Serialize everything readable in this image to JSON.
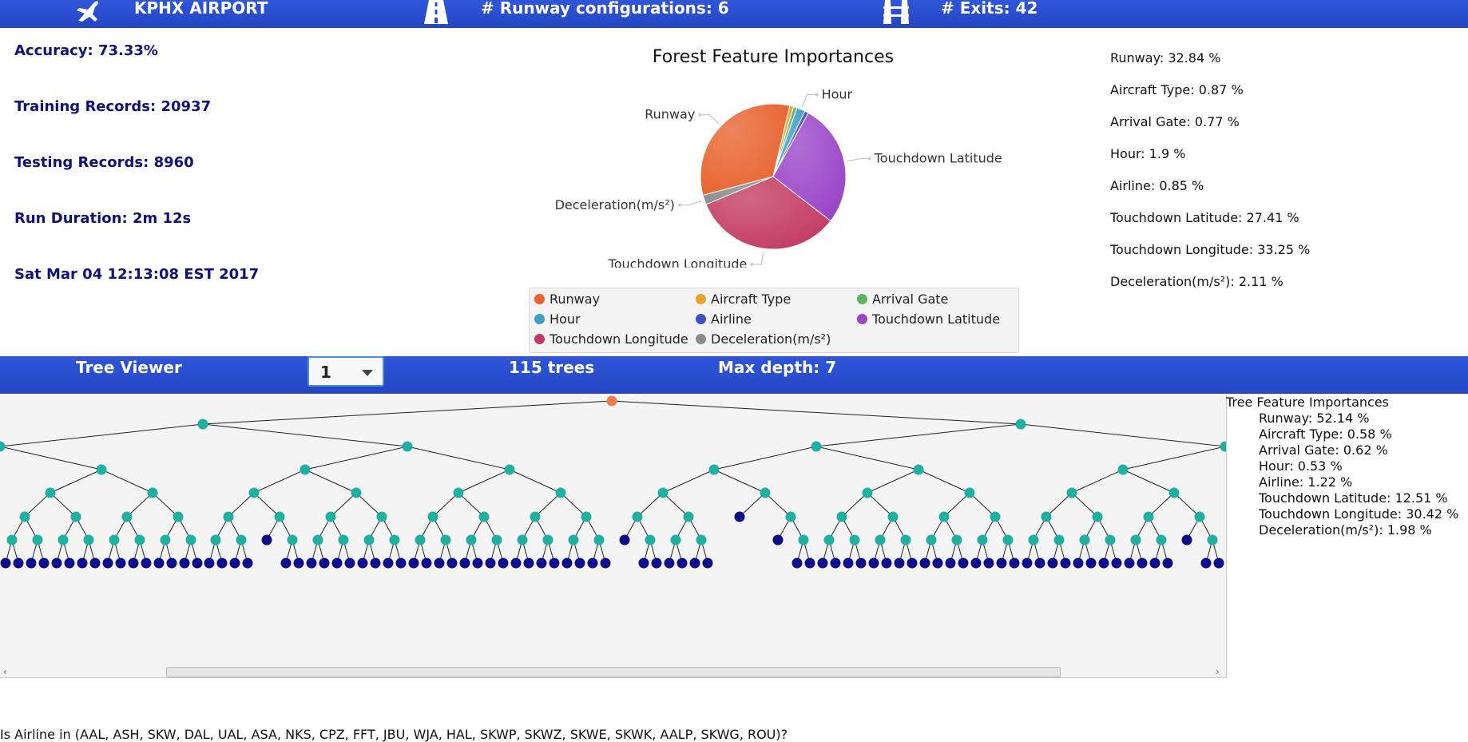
{
  "header": {
    "airport": "KPHX AIRPORT",
    "runway_configs": "# Runway configurations: 6",
    "exits": "# Exits: 42",
    "icons": [
      "airplane-icon",
      "runway-icon",
      "exit-icon"
    ]
  },
  "stats": {
    "accuracy": "Accuracy: 73.33%",
    "training": "Training Records: 20937",
    "testing": "Testing Records: 8960",
    "duration": "Run Duration: 2m 12s",
    "date": "Sat Mar 04 12:13:08 EST 2017"
  },
  "chart_data": {
    "type": "pie",
    "title": "Forest Feature Importances",
    "slices": [
      {
        "label": "Runway",
        "value": 32.84,
        "color": "#e8632e"
      },
      {
        "label": "Aircraft Type",
        "value": 0.87,
        "color": "#eba22b"
      },
      {
        "label": "Arrival Gate",
        "value": 0.77,
        "color": "#5cb35c"
      },
      {
        "label": "Hour",
        "value": 1.9,
        "color": "#3e9fc8"
      },
      {
        "label": "Airline",
        "value": 0.85,
        "color": "#3e52c6"
      },
      {
        "label": "Touchdown Latitude",
        "value": 27.41,
        "color": "#9a45c8"
      },
      {
        "label": "Touchdown Longitude",
        "value": 33.25,
        "color": "#c33b62"
      },
      {
        "label": "Deceleration(m/s²)",
        "value": 2.11,
        "color": "#8a8a8a"
      }
    ],
    "visible_labels": [
      "Runway",
      "Hour",
      "Touchdown Latitude",
      "Touchdown Longitude",
      "Deceleration(m/s²)"
    ],
    "legend_position": "bottom"
  },
  "legend": [
    {
      "label": "Runway",
      "color": "#e8632e"
    },
    {
      "label": "Aircraft Type",
      "color": "#eba22b"
    },
    {
      "label": "Arrival Gate",
      "color": "#5cb35c"
    },
    {
      "label": "Hour",
      "color": "#3e9fc8"
    },
    {
      "label": "Airline",
      "color": "#3e52c6"
    },
    {
      "label": "Touchdown Latitude",
      "color": "#9a45c8"
    },
    {
      "label": "Touchdown Longitude",
      "color": "#c33b62"
    },
    {
      "label": "Deceleration(m/s²)",
      "color": "#8a8a8a"
    }
  ],
  "forest_importances": [
    "Runway: 32.84 %",
    "Aircraft Type: 0.87 %",
    "Arrival Gate: 0.77 %",
    "Hour: 1.9 %",
    "Airline: 0.85 %",
    "Touchdown Latitude: 27.41 %",
    "Touchdown Longitude: 33.25 %",
    "Deceleration(m/s²): 2.11 %"
  ],
  "tree_viewer": {
    "title": "Tree Viewer",
    "selected_tree": "1",
    "tree_count": "115 trees",
    "max_depth": "Max depth: 7"
  },
  "tree_importances": {
    "title": "Tree Feature Importances",
    "items": [
      "Runway: 52.14 %",
      "Aircraft Type: 0.58 %",
      "Arrival Gate: 0.62 %",
      "Hour: 0.53 %",
      "Airline: 1.22 %",
      "Touchdown Latitude: 12.51 %",
      "Touchdown Longitude: 30.42 %",
      "Deceleration(m/s²): 1.98 %"
    ]
  },
  "question": "Is Airline in (AAL, ASH, SKW, DAL, UAL, ASA, NKS, CPZ, FFT, JBU, WJA, HAL, SKWP, SKWZ, SKWE, SKWK, AALP, SKWG, ROU)?",
  "colors": {
    "bar": "#2a4fd2",
    "stat_text": "#10107a",
    "root_node": "#f07a4e",
    "inner_node": "#1fb0a4",
    "leaf_node": "#0c0c8a"
  }
}
